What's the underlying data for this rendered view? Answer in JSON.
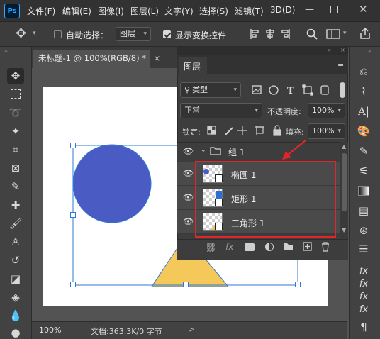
{
  "app": {
    "logo": "Ps"
  },
  "menu": [
    "文件(F)",
    "编辑(E)",
    "图像(I)",
    "图层(L)",
    "文字(Y)",
    "选择(S)",
    "滤镜(T)",
    "3D(D)"
  ],
  "window_controls": [
    "minimize-icon",
    "maximize-icon",
    "close-icon"
  ],
  "options_bar": {
    "auto_select_label": "自动选择：",
    "auto_select_target": "图层",
    "show_transform_label": "显示变换控件"
  },
  "document_tab": {
    "title": "未标题-1 @ 100%(RGB/8) *",
    "close": "×"
  },
  "status_bar": {
    "zoom": "100%",
    "doc_info": "文档:363.3K/0 字节",
    "arrow": ">"
  },
  "layers_panel": {
    "tab_label": "图层",
    "filter_kind": "类型",
    "blend_mode": "正常",
    "opacity_label": "不透明度:",
    "opacity_value": "100%",
    "lock_label": "锁定:",
    "fill_label": "填充:",
    "fill_value": "100%",
    "group": {
      "name": "组 1"
    },
    "layers": [
      {
        "name": "椭圆 1",
        "badge_color": "#4a5bc4"
      },
      {
        "name": "矩形 1",
        "badge_color": "#2a6fd6"
      },
      {
        "name": "三角形 1",
        "badge_color": "#f0c24a"
      }
    ]
  },
  "colors": {
    "circle": "#4a5bc4",
    "triangle": "#f4c95a",
    "highlight": "#e0262b",
    "selection": "#2f79d6"
  }
}
